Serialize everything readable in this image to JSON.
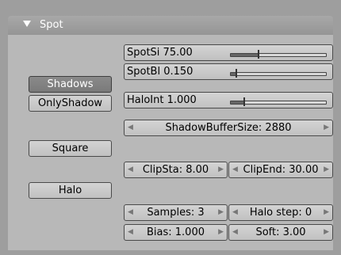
{
  "panel": {
    "title": "Spot"
  },
  "toggles": {
    "shadows": "Shadows",
    "only_shadow": "OnlyShadow",
    "square": "Square",
    "halo": "Halo"
  },
  "sliders": {
    "spot_si": {
      "label": "SpotSi 75.00",
      "fraction": 0.29
    },
    "spot_bl": {
      "label": "SpotBl 0.150",
      "fraction": 0.06
    },
    "halo_int": {
      "label": "HaloInt 1.000",
      "fraction": 0.14
    }
  },
  "fields": {
    "shadow_buffer_size": "ShadowBufferSize: 2880",
    "clip_sta": "ClipSta: 8.00",
    "clip_end": "ClipEnd: 30.00",
    "samples": "Samples: 3",
    "halo_step": "Halo step: 0",
    "bias": "Bias: 1.000",
    "soft": "Soft: 3.00"
  },
  "icons": {
    "collapse": "triangle-down-icon",
    "decrement": "arrow-left-icon",
    "increment": "arrow-right-icon"
  }
}
